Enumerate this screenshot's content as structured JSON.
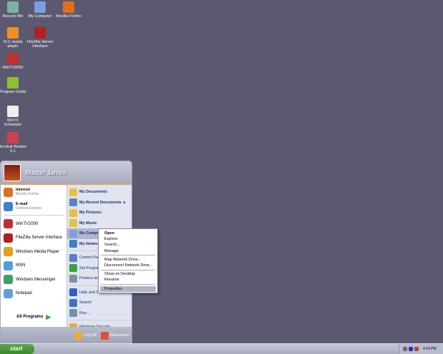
{
  "desktop": {
    "icons": [
      {
        "label": "Recycle Bin",
        "color": "#7fb0a0"
      },
      {
        "label": "My Computer",
        "color": "#7aa0e0"
      },
      {
        "label": "Mozilla Firefox",
        "color": "#e07020"
      },
      {
        "label": "VLC media player",
        "color": "#f09020"
      },
      {
        "label": "FileZilla Server Interface",
        "color": "#b02020"
      },
      {
        "label": "WinTV2000",
        "color": "#c03030"
      },
      {
        "label": "Program Guide",
        "color": "#90c030"
      },
      {
        "label": "WinTV Scheduler",
        "color": "#eeeeee"
      },
      {
        "label": "Acrobat Reader 5.1",
        "color": "#d04050"
      }
    ]
  },
  "start_menu": {
    "user": "Master James",
    "pinned": [
      {
        "title": "Internet",
        "sub": "Mozilla Firefox",
        "color": "#e07020"
      },
      {
        "title": "E-mail",
        "sub": "Outlook Express",
        "color": "#4080d0"
      }
    ],
    "recent": [
      {
        "label": "WinTV2000",
        "color": "#c03030"
      },
      {
        "label": "FileZilla Server Interface",
        "color": "#b02020"
      },
      {
        "label": "Windows Media Player",
        "color": "#e0a020"
      },
      {
        "label": "MSN",
        "color": "#50a0e0"
      },
      {
        "label": "Windows Messenger",
        "color": "#40a060"
      },
      {
        "label": "Notepad",
        "color": "#60a0e0"
      }
    ],
    "all_programs": "All Programs",
    "right": [
      {
        "label": "My Documents",
        "bold": true,
        "color": "#e8c040"
      },
      {
        "label": "My Recent Documents",
        "bold": true,
        "color": "#6080c0",
        "arrow": "▸"
      },
      {
        "label": "My Pictures",
        "bold": true,
        "color": "#e8c040"
      },
      {
        "label": "My Music",
        "bold": true,
        "color": "#e8c040"
      },
      {
        "label": "My Computer",
        "bold": true,
        "color": "#7aa0e0",
        "hl": true
      },
      {
        "label": "My Network Places",
        "bold": true,
        "color": "#4080c0"
      },
      {
        "sep": true
      },
      {
        "label": "Control Panel",
        "color": "#6080c0"
      },
      {
        "label": "Set Program Access and Defaults",
        "color": "#40a040"
      },
      {
        "label": "Printers and Faxes",
        "color": "#8090a0"
      },
      {
        "sep": true
      },
      {
        "label": "Help and Support",
        "color": "#3060c0"
      },
      {
        "label": "Search",
        "color": "#4070c0"
      },
      {
        "label": "Run...",
        "color": "#7090b0"
      },
      {
        "sep": true
      },
      {
        "label": "Windows Security",
        "color": "#e0b030"
      }
    ],
    "log_off": "Log Off",
    "disconnect": "Disconnect"
  },
  "context_menu": [
    {
      "label": "Open",
      "bold": true
    },
    {
      "label": "Explore"
    },
    {
      "label": "Search..."
    },
    {
      "label": "Manage"
    },
    {
      "sep": true
    },
    {
      "label": "Map Network Drive..."
    },
    {
      "label": "Disconnect Network Drive..."
    },
    {
      "sep": true
    },
    {
      "label": "Show on Desktop"
    },
    {
      "label": "Rename"
    },
    {
      "sep": true
    },
    {
      "label": "Properties",
      "hl": true
    }
  ],
  "taskbar": {
    "start": "start",
    "clock": "4:14 PM"
  }
}
